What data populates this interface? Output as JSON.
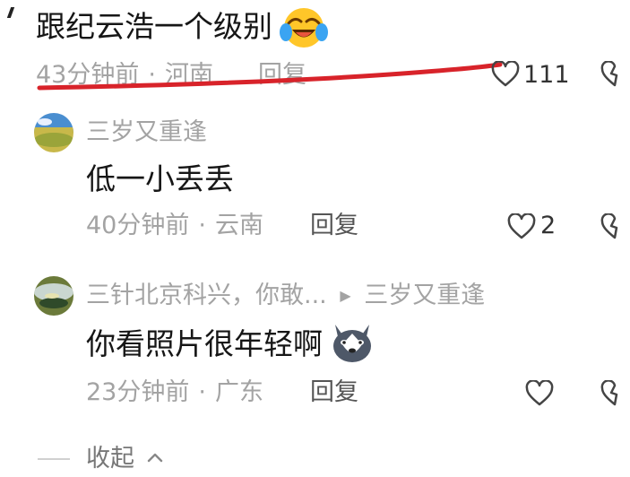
{
  "top_comment": {
    "text": "跟纪云浩一个级别",
    "time": "43分钟前",
    "location": "河南",
    "reply_label": "回复",
    "likes": "111"
  },
  "replies": [
    {
      "username": "三岁又重逢",
      "text": "低一小丢丢",
      "time": "40分钟前",
      "location": "云南",
      "reply_label": "回复",
      "likes": "2"
    },
    {
      "username": "三针北京科兴，你敢...",
      "reply_to": "三岁又重逢",
      "text": "你看照片很年轻啊",
      "time": "23分钟前",
      "location": "广东",
      "reply_label": "回复",
      "likes": ""
    }
  ],
  "collapse_label": "收起",
  "icons": [
    "laughing-crying-emoji-icon",
    "heart-icon",
    "dislike-icon",
    "play-arrow-icon",
    "husky-emoji-icon",
    "chevron-up-icon"
  ],
  "colors": {
    "annotation_red": "#d8232a",
    "meta_gray": "#a3a3a3"
  }
}
